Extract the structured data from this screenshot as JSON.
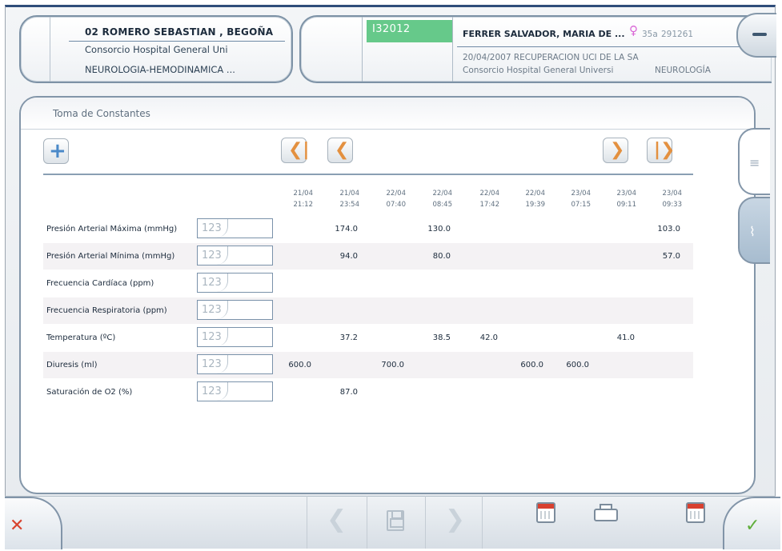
{
  "patient_card": {
    "name": "02 ROMERO SEBASTIAN , BEGOÑA",
    "hospital": "Consorcio Hospital General Uni",
    "service": "NEUROLOGIA-HEMODINAMICA ..."
  },
  "episode_card": {
    "code": "I32012",
    "code_color": "#66c98a",
    "patient": "FERRER SALVADOR, MARIA DE ...",
    "sex_icon": "female-icon",
    "age": "35a",
    "history_number": "291261",
    "admission": "20/04/2007  RECUPERACION UCI DE LA SA",
    "hospital": "Consorcio Hospital General Universi",
    "department": "NEUROLOGÍA"
  },
  "panel": {
    "title": "Toma de Constantes"
  },
  "toolbar": {
    "add_icon": "plus-icon",
    "first_icon": "first-page-icon",
    "prev_icon": "previous-page-icon",
    "next_icon": "next-page-icon",
    "last_icon": "last-page-icon",
    "accent_color": "#e3903f"
  },
  "columns": [
    {
      "date": "21/04",
      "time": "21:12"
    },
    {
      "date": "21/04",
      "time": "23:54"
    },
    {
      "date": "22/04",
      "time": "07:40"
    },
    {
      "date": "22/04",
      "time": "08:45"
    },
    {
      "date": "22/04",
      "time": "17:42"
    },
    {
      "date": "22/04",
      "time": "19:39"
    },
    {
      "date": "23/04",
      "time": "07:15"
    },
    {
      "date": "23/04",
      "time": "09:11"
    },
    {
      "date": "23/04",
      "time": "09:33"
    }
  ],
  "rows": [
    {
      "label": "Presión Arterial Máxima  (mmHg)",
      "placeholder": "123",
      "values": [
        "",
        "174.0",
        "",
        "130.0",
        "",
        "",
        "",
        "",
        "103.0"
      ]
    },
    {
      "label": "Presión Arterial Mínima  (mmHg)",
      "placeholder": "123",
      "values": [
        "",
        "94.0",
        "",
        "80.0",
        "",
        "",
        "",
        "",
        "57.0"
      ]
    },
    {
      "label": "Frecuencia Cardíaca  (ppm)",
      "placeholder": "123",
      "values": [
        "",
        "",
        "",
        "",
        "",
        "",
        "",
        "",
        ""
      ]
    },
    {
      "label": "Frecuencia Respiratoria  (ppm)",
      "placeholder": "123",
      "values": [
        "",
        "",
        "",
        "",
        "",
        "",
        "",
        "",
        ""
      ]
    },
    {
      "label": "Temperatura  (ºC)",
      "placeholder": "123",
      "values": [
        "",
        "37.2",
        "",
        "38.5",
        "42.0",
        "",
        "",
        "41.0",
        ""
      ]
    },
    {
      "label": "Diuresis  (ml)",
      "placeholder": "123",
      "values": [
        "600.0",
        "",
        "700.0",
        "",
        "",
        "600.0",
        "600.0",
        "",
        ""
      ]
    },
    {
      "label": "Saturación de O2  (%)",
      "placeholder": "123",
      "values": [
        "",
        "87.0",
        "",
        "",
        "",
        "",
        "",
        "",
        ""
      ]
    }
  ],
  "side_tabs": [
    {
      "name": "list-view-tab",
      "icon": "list-icon"
    },
    {
      "name": "chart-view-tab",
      "icon": "line-chart-icon"
    }
  ],
  "bottom_bar": {
    "cancel_icon": "close-icon",
    "cancel_color": "#d8432e",
    "accept_icon": "check-icon",
    "accept_color": "#5fae3a",
    "tools": [
      "previous-icon",
      "save-icon",
      "next-icon",
      "calendar-icon",
      "printer-icon",
      "calendar-icon"
    ]
  }
}
